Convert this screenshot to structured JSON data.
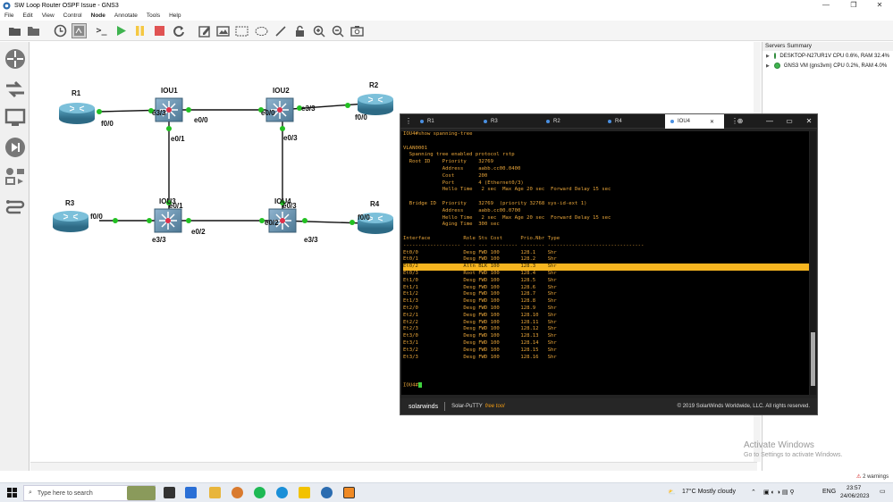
{
  "window": {
    "title": "SW Loop Router OSPF Issue - GNS3"
  },
  "menu": [
    "File",
    "Edit",
    "View",
    "Control",
    "Node",
    "Annotate",
    "Tools",
    "Help"
  ],
  "toolbar_icons": [
    "open-project-icon",
    "folder-icon",
    "snapshot-icon",
    "show-interface-labels-icon",
    "console-icon",
    "start-icon",
    "pause-icon",
    "stop-icon",
    "reload-icon",
    "note-icon",
    "image-icon",
    "rectangle-icon",
    "ellipse-icon",
    "line-icon",
    "lock-icon",
    "zoom-in-icon",
    "zoom-out-icon",
    "screenshot-icon"
  ],
  "topology": {
    "nodes": [
      {
        "id": "R1",
        "label": "R1",
        "type": "router"
      },
      {
        "id": "R2",
        "label": "R2",
        "type": "router"
      },
      {
        "id": "R3",
        "label": "R3",
        "type": "router"
      },
      {
        "id": "R4",
        "label": "R4",
        "type": "router"
      },
      {
        "id": "IOU1",
        "label": "IOU1",
        "type": "switch"
      },
      {
        "id": "IOU2",
        "label": "IOU2",
        "type": "switch"
      },
      {
        "id": "IOU3",
        "label": "IOU3",
        "type": "switch"
      },
      {
        "id": "IOU4",
        "label": "IOU4",
        "type": "switch"
      }
    ],
    "port_labels": {
      "r1_f00": "f0/0",
      "iou1_e33": "e3/3",
      "iou1_e00": "e0/0",
      "iou1_e01": "e0/1",
      "iou2_e00": "e0/0",
      "iou2_e33": "e3/3",
      "iou2_e03": "e0/3",
      "r2_f00": "f0/0",
      "r3_f00": "f0/0",
      "iou3_e01": "e0/1",
      "iou3_e33": "e3/3",
      "iou3_e02": "e0/2",
      "iou4_e03": "e0/3",
      "iou4_e02": "e0/2",
      "iou4_e33": "e3/3",
      "r4_f00": "f0/0"
    }
  },
  "servers": {
    "title": "Servers Summary",
    "items": [
      "DESKTOP-N27UR1V CPU 0.6%, RAM 32.4%",
      "GNS3 VM (gns3vm) CPU 0.2%, RAM 4.0%"
    ]
  },
  "putty": {
    "tabs": [
      "R1",
      "R3",
      "R2",
      "R4",
      "IOU4"
    ],
    "active_tab": "IOU4",
    "footer_brand": "solarwinds",
    "footer_product": "Solar-PuTTY",
    "footer_free": "free tool",
    "copyright": "© 2019 SolarWinds Worldwide, LLC. All rights reserved.",
    "terminal": {
      "lines": [
        "IOU4#show spanning-tree",
        "",
        "VLAN0001",
        "  Spanning tree enabled protocol rstp",
        "  Root ID    Priority    32769",
        "             Address     aabb.cc00.0400",
        "             Cost        200",
        "             Port        4 (Ethernet0/3)",
        "             Hello Time   2 sec  Max Age 20 sec  Forward Delay 15 sec",
        "",
        "  Bridge ID  Priority    32769  (priority 32768 sys-id-ext 1)",
        "             Address     aabb.cc00.0700",
        "             Hello Time   2 sec  Max Age 20 sec  Forward Delay 15 sec",
        "             Aging Time  300 sec",
        "",
        "Interface           Role Sts Cost      Prio.Nbr Type",
        "------------------- ---- --- --------- -------- --------------------------------",
        "Et0/0               Desg FWD 100       128.1    Shr",
        "Et0/1               Desg FWD 100       128.2    Shr",
        "Et0/2               Altn BLK 100       128.3    Shr",
        "Et0/3               Root FWD 100       128.4    Shr",
        "Et1/0               Desg FWD 100       128.5    Shr",
        "Et1/1               Desg FWD 100       128.6    Shr",
        "Et1/2               Desg FWD 100       128.7    Shr",
        "Et1/3               Desg FWD 100       128.8    Shr",
        "Et2/0               Desg FWD 100       128.9    Shr",
        "Et2/1               Desg FWD 100       128.10   Shr",
        "Et2/2               Desg FWD 100       128.11   Shr",
        "Et2/3               Desg FWD 100       128.12   Shr",
        "Et3/0               Desg FWD 100       128.13   Shr",
        "Et3/1               Desg FWD 100       128.14   Shr",
        "Et3/2               Desg FWD 100       128.15   Shr",
        "Et3/3               Desg FWD 100       128.16   Shr",
        "",
        "",
        "",
        "IOU4#"
      ],
      "highlight_line": 19,
      "prompt_line": 36
    }
  },
  "watermark": {
    "title": "Activate Windows",
    "subtitle": "Go to Settings to activate Windows."
  },
  "warnings": "2 warnings",
  "taskbar": {
    "search_placeholder": "Type here to search",
    "weather": "17°C  Mostly cloudy",
    "lang": "ENG",
    "time": "23:57",
    "date": "24/06/2023"
  }
}
